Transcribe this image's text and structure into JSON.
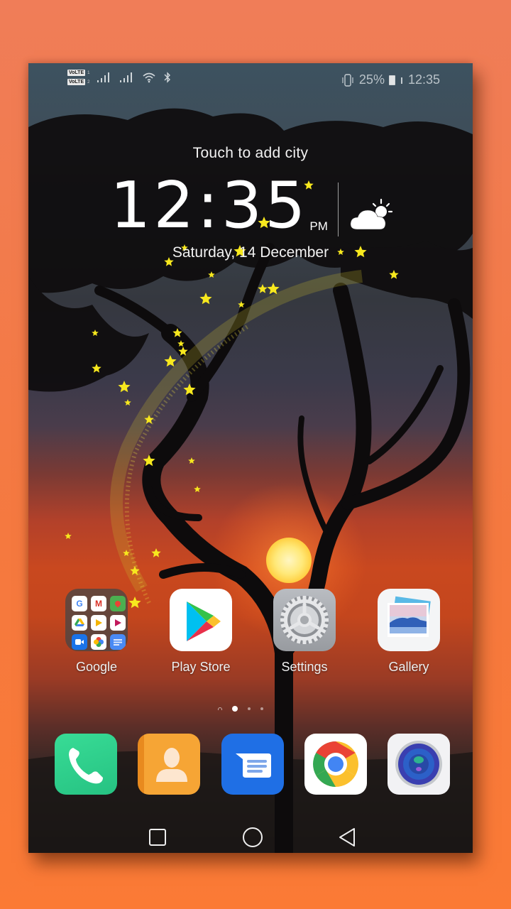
{
  "status_bar": {
    "sim1_label": "VoLTE",
    "sim2_label": "VoLTE",
    "sim1_sub": "1",
    "sim2_sub": "2",
    "left_icons": [
      "signal-sim1-icon",
      "signal-sim2-icon",
      "wifi-icon",
      "bluetooth-icon"
    ],
    "right_icons": [
      "vibrate-icon",
      "battery-icon",
      "signal-small-icon"
    ],
    "battery_percent": "25%",
    "battery_level": 0.25,
    "time": "12:35"
  },
  "clock_widget": {
    "city_prompt": "Touch to add city",
    "time": "12:35",
    "ampm": "PM",
    "weather_icon": "partly-cloudy-icon",
    "date": "Saturday, 14 December"
  },
  "apps": [
    {
      "label": "Google",
      "icon": "google-folder-icon"
    },
    {
      "label": "Play Store",
      "icon": "play-store-icon"
    },
    {
      "label": "Settings",
      "icon": "settings-gear-icon"
    },
    {
      "label": "Gallery",
      "icon": "gallery-icon"
    }
  ],
  "google_folder_items": [
    "G",
    "M",
    "Maps",
    "Drive",
    "Play",
    "Movies",
    "Duo",
    "Photos",
    "Docs"
  ],
  "page_indicator": {
    "pages": 3,
    "active": 1,
    "has_home_marker": true
  },
  "dock": [
    {
      "name": "Phone",
      "icon": "phone-icon",
      "color": "#2fd08a"
    },
    {
      "name": "Contacts",
      "icon": "contacts-icon",
      "color": "#f5a030"
    },
    {
      "name": "Messages",
      "icon": "messages-icon",
      "color": "#1f6fe5"
    },
    {
      "name": "Chrome",
      "icon": "chrome-icon",
      "color": "#ffffff"
    },
    {
      "name": "Camera",
      "icon": "camera-icon",
      "color": "#f2f2f2"
    }
  ],
  "nav_bar": {
    "buttons": [
      "recents-button",
      "home-button",
      "back-button"
    ]
  },
  "colors": {
    "frame_background": "#f5793f",
    "star_yellow": "#f7e81e"
  }
}
